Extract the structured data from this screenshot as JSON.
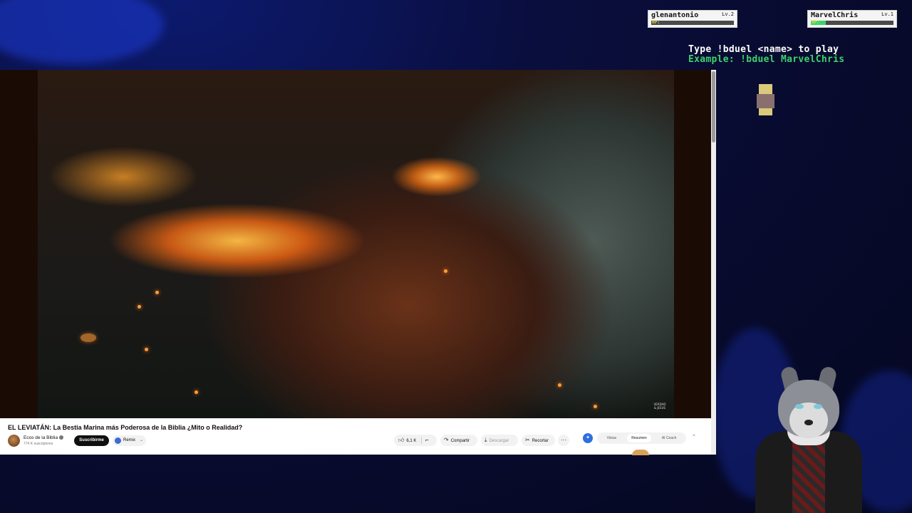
{
  "overlay": {
    "players": [
      {
        "name": "glenantonio",
        "level": "Lv.2",
        "hp_label": "HP:",
        "hp_fraction": 0.0
      },
      {
        "name": "MarvelChris",
        "level": "Lv.1",
        "hp_label": "HP:",
        "hp_fraction": 0.18
      }
    ],
    "instructions": {
      "line1": "Type !bduel <name> to play",
      "line2": "Example: !bduel MarvelChris"
    },
    "colors": {
      "accent_green": "#3cd26b",
      "background": "#070a2a"
    }
  },
  "video": {
    "title": "EL LEVIATÁN: La Bestia Marina más Poderosa de la Biblia ¿Mito o Realidad?",
    "channel": {
      "name": "Ecos de la Biblia",
      "subscribers": "774 K suscriptores",
      "verified_icon": "verified-icon"
    },
    "subscribe_label": "Suscribirme",
    "remix_label": "Remix",
    "actions": {
      "likes": "6,1 K",
      "share": "Compartir",
      "download": "Descargar",
      "clip": "Recortar",
      "more": "···"
    },
    "ai_tabs": [
      "Vistas",
      "Resumen",
      "AI Coach"
    ],
    "ai_tab_active": "Resumen",
    "watermark": "VERDAD & JESUS"
  }
}
